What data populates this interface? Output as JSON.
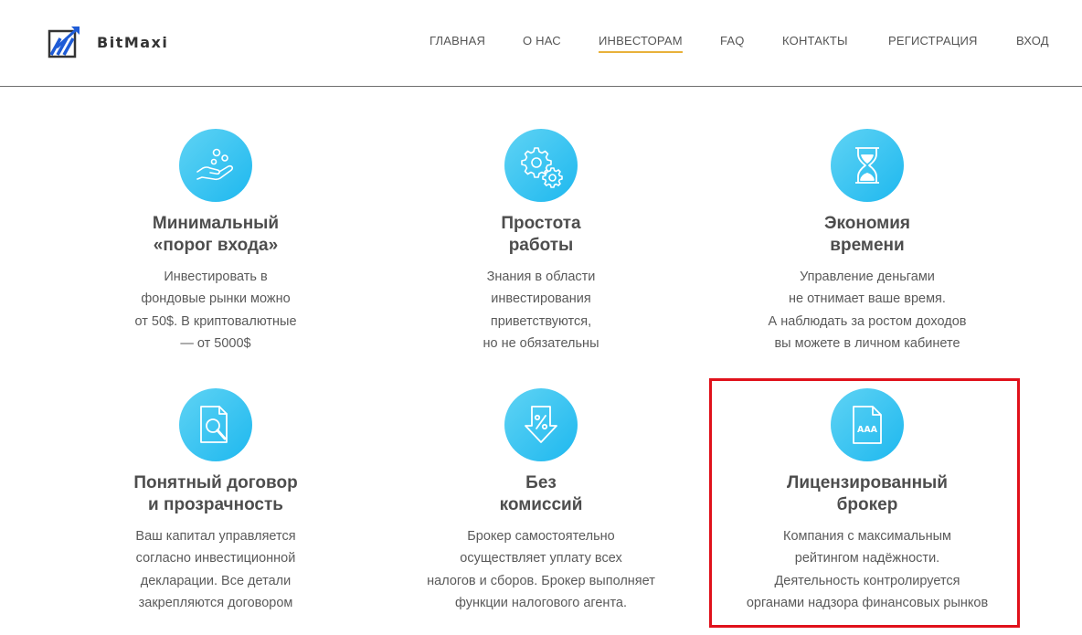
{
  "brand": {
    "name": "BitMaxi"
  },
  "nav": {
    "items": [
      {
        "label": "ГЛАВНАЯ",
        "active": false
      },
      {
        "label": "О НАС",
        "active": false
      },
      {
        "label": "ИНВЕСТОРАМ",
        "active": true
      },
      {
        "label": "FAQ",
        "active": false
      },
      {
        "label": "КОНТАКТЫ",
        "active": false
      },
      {
        "label": "РЕГИСТРАЦИЯ",
        "active": false
      },
      {
        "label": "ВХОД",
        "active": false
      }
    ],
    "active_underline_color": "#e8b13a"
  },
  "features": [
    {
      "icon": "hand-coins-icon",
      "title": "Минимальный\n«порог входа»",
      "description": "Инвестировать в\nфондовые рынки можно\nот 50$. В криптовалютные\n— от 5000$"
    },
    {
      "icon": "gears-icon",
      "title": "Простота\nработы",
      "description": "Знания в области\nинвестирования\nприветствуются,\nно не обязательны"
    },
    {
      "icon": "hourglass-icon",
      "title": "Экономия\nвремени",
      "description": "Управление деньгами\nне отнимает ваше время.\nА наблюдать за ростом доходов\nвы можете в личном кабинете"
    },
    {
      "icon": "document-search-icon",
      "title": "Понятный договор\nи прозрачность",
      "description": "Ваш капитал управляется\nсогласно инвестиционной\nдекларации. Все детали\nзакрепляются договором"
    },
    {
      "icon": "percent-arrow-icon",
      "title": "Без\nкомиссий",
      "description": "Брокер самостоятельно\nосуществляет уплату всех\nналогов и сборов. Брокер выполняет\nфункции налогового агента."
    },
    {
      "icon": "aaa-document-icon",
      "icon_text": "AAA",
      "title": "Лицензированный\nброкер",
      "description": "Компания с максимальным\nрейтингом надёжности.\nДеятельность контролируется\nорганами надзора финансовых рынков",
      "highlighted": true
    }
  ],
  "colors": {
    "icon_gradient_start": "#5fd3f4",
    "icon_gradient_end": "#1eb8ef",
    "highlight_border": "#e0111b",
    "logo_blue": "#1e5bd6"
  }
}
